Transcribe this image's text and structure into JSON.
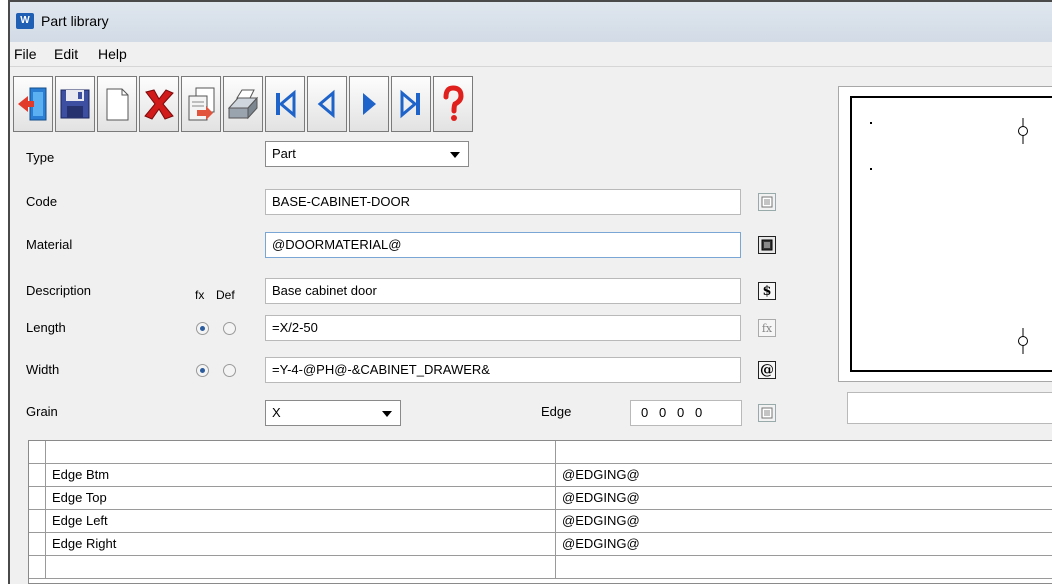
{
  "window": {
    "title": "Part library",
    "app_icon_text": "W"
  },
  "menu": [
    "File",
    "Edit",
    "Help"
  ],
  "toolbar": [
    {
      "name": "exit-icon"
    },
    {
      "name": "save-icon"
    },
    {
      "name": "new-icon"
    },
    {
      "name": "delete-icon"
    },
    {
      "name": "copy-icon"
    },
    {
      "name": "print-icon"
    },
    {
      "name": "first-record-icon"
    },
    {
      "name": "previous-record-icon"
    },
    {
      "name": "next-record-icon"
    },
    {
      "name": "last-record-icon"
    },
    {
      "name": "help-icon"
    }
  ],
  "form": {
    "type_label": "Type",
    "type_value": "Part",
    "code_label": "Code",
    "code_value": "BASE-CABINET-DOOR",
    "material_label": "Material",
    "material_value": "@DOORMATERIAL@",
    "description_label": "Description",
    "description_value": "Base cabinet door",
    "fx_label": "fx",
    "def_label": "Def",
    "length_label": "Length",
    "length_value": "=X/2-50",
    "width_label": "Width",
    "width_value": "=Y-4-@PH@-&CABINET_DRAWER&",
    "grain_label": "Grain",
    "grain_value": "X",
    "edge_label": "Edge",
    "edge_values": [
      "0",
      "0",
      "0",
      "0"
    ]
  },
  "side_buttons": {
    "code": "list-icon",
    "material": "list-icon",
    "description": "$",
    "length": "fx",
    "width": "@",
    "edge": "list-icon"
  },
  "grid": {
    "rows": [
      {
        "name": "",
        "value": ""
      },
      {
        "name": "Edge Btm",
        "value": "@EDGING@"
      },
      {
        "name": "Edge Top",
        "value": "@EDGING@"
      },
      {
        "name": "Edge Left",
        "value": "@EDGING@"
      },
      {
        "name": "Edge Right",
        "value": "@EDGING@"
      },
      {
        "name": "",
        "value": ""
      }
    ]
  },
  "colors": {
    "accent": "#1f5fb4",
    "delete": "#d11a1a",
    "nav_arrow": "#1e63c9",
    "help": "#e0201c"
  }
}
